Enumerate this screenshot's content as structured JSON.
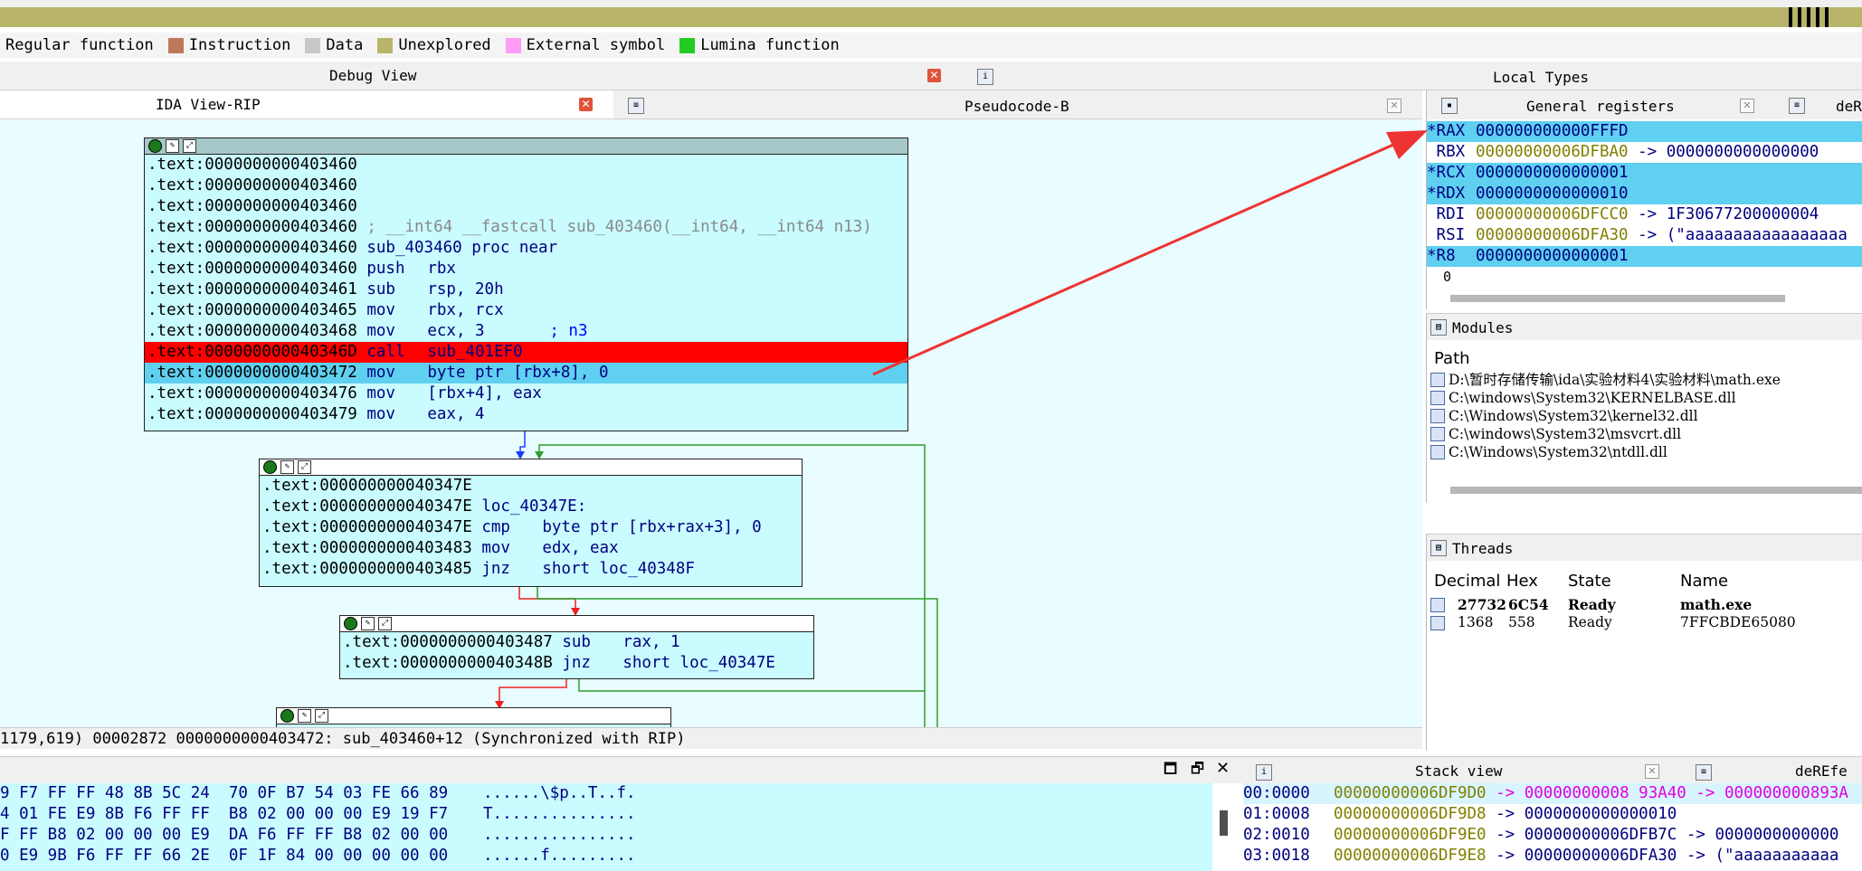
{
  "colors": {
    "nav_band": "#b8b46a",
    "graph_bg": "#e9fcff",
    "node_bg": "#c9fbff",
    "highlight_current": "#5fd0f0",
    "highlight_breakpoint": "#ff0000",
    "arrow": "#ee3333",
    "register_changed": "#5fd0f0"
  },
  "legend": [
    {
      "label": "Regular function",
      "color": "none"
    },
    {
      "label": "Instruction",
      "color": "#c0785a"
    },
    {
      "label": "Data",
      "color": "#c8c8c8"
    },
    {
      "label": "Unexplored",
      "color": "#b8b46a"
    },
    {
      "label": "External symbol",
      "color": "#ff9cf8"
    },
    {
      "label": "Lumina function",
      "color": "#22cc22"
    }
  ],
  "tabs": {
    "debug_view": "Debug View",
    "local_types": "Local Types",
    "ida_view": "IDA View-RIP",
    "pseudocode": "Pseudocode-B",
    "general_registers": "General registers",
    "dere_top": "deRe",
    "modules": "Modules",
    "threads": "Threads",
    "stack_view": "Stack view",
    "dere_bottom": "deREfe"
  },
  "node1": [
    {
      "addr": ".text:0000000000403460",
      "mnem": "",
      "ops": "",
      "style": ""
    },
    {
      "addr": ".text:0000000000403460",
      "mnem": "",
      "ops": "",
      "style": ""
    },
    {
      "addr": ".text:0000000000403460",
      "mnem": "",
      "ops": "",
      "style": ""
    },
    {
      "addr": ".text:0000000000403460",
      "mnem": "; __int64 __fastcall sub_403460(__int64, __int64 n13)",
      "ops": "",
      "style": "comment"
    },
    {
      "addr": ".text:0000000000403460",
      "mnem": "sub_403460 proc near",
      "ops": "",
      "style": ""
    },
    {
      "addr": ".text:0000000000403460",
      "mnem": "push",
      "ops": "rbx",
      "style": ""
    },
    {
      "addr": ".text:0000000000403461",
      "mnem": "sub",
      "ops": "rsp, 20h",
      "style": ""
    },
    {
      "addr": ".text:0000000000403465",
      "mnem": "mov",
      "ops": "rbx, rcx",
      "style": ""
    },
    {
      "addr": ".text:0000000000403468",
      "mnem": "mov",
      "ops": "ecx, 3",
      "comment": "; n3",
      "style": ""
    },
    {
      "addr": ".text:000000000040346D",
      "mnem": "call",
      "ops": "sub_401EF0",
      "style": "breakpoint"
    },
    {
      "addr": ".text:0000000000403472",
      "mnem": "mov",
      "ops": "byte ptr [rbx+8], 0",
      "style": "current"
    },
    {
      "addr": ".text:0000000000403476",
      "mnem": "mov",
      "ops": "[rbx+4], eax",
      "style": ""
    },
    {
      "addr": ".text:0000000000403479",
      "mnem": "mov",
      "ops": "eax, 4",
      "style": ""
    }
  ],
  "node2": [
    {
      "addr": ".text:000000000040347E",
      "mnem": "",
      "ops": ""
    },
    {
      "addr": ".text:000000000040347E",
      "mnem": "loc_40347E:",
      "ops": ""
    },
    {
      "addr": ".text:000000000040347E",
      "mnem": "cmp",
      "ops": "byte ptr [rbx+rax+3], 0"
    },
    {
      "addr": ".text:0000000000403483",
      "mnem": "mov",
      "ops": "edx, eax"
    },
    {
      "addr": ".text:0000000000403485",
      "mnem": "jnz",
      "ops": "short loc_40348F"
    }
  ],
  "node3": [
    {
      "addr": ".text:0000000000403487",
      "mnem": "sub",
      "ops": "rax, 1"
    },
    {
      "addr": ".text:000000000040348B",
      "mnem": "jnz",
      "ops": "short loc_40347E"
    }
  ],
  "status": {
    "coords": "1179,619)",
    "offset": "00002872",
    "location": "0000000000403472: sub_403460+12",
    "sync": "(Synchronized with RIP)"
  },
  "registers": [
    {
      "name": "*RAX",
      "value": "000000000000FFFD",
      "deref": "",
      "changed": true
    },
    {
      "name": " RBX",
      "value": "00000000006DFBA0",
      "deref": "-> 0000000000000000",
      "changed": false
    },
    {
      "name": "*RCX",
      "value": "0000000000000001",
      "deref": "",
      "changed": true
    },
    {
      "name": "*RDX",
      "value": "0000000000000010",
      "deref": "",
      "changed": true
    },
    {
      "name": " RDI",
      "value": "00000000006DFCC0",
      "deref": "-> 1F30677200000004",
      "changed": false
    },
    {
      "name": " RSI",
      "value": "00000000006DFA30",
      "deref": "-> (\"aaaaaaaaaaaaaaaaa",
      "changed": false
    },
    {
      "name": "*R8",
      "value": "0000000000000001",
      "deref": "",
      "changed": true
    }
  ],
  "registers_footer": "0",
  "modules": {
    "header": "Path",
    "items": [
      "D:\\暂时存储传输\\ida\\实验材料4\\实验材料\\math.exe",
      "C:\\windows\\System32\\KERNELBASE.dll",
      "C:\\Windows\\System32\\kernel32.dll",
      "C:\\windows\\System32\\msvcrt.dll",
      "C:\\Windows\\System32\\ntdll.dll"
    ]
  },
  "threads": {
    "columns": [
      "Decimal",
      "Hex",
      "State",
      "Name"
    ],
    "rows": [
      {
        "decimal": "27732",
        "hex": "6C54",
        "state": "Ready",
        "name": "math.exe",
        "bold": true
      },
      {
        "decimal": "1368",
        "hex": "558",
        "state": "Ready",
        "name": "7FFCBDE65080",
        "bold": false
      }
    ]
  },
  "hexdump": [
    {
      "bytes": "9 F7 FF FF 48 8B 5C 24  70 0F B7 54 03 FE 66 89",
      "ascii": "......\\$p..T..f."
    },
    {
      "bytes": "4 01 FE E9 8B F6 FF FF  B8 02 00 00 00 E9 19 F7",
      "ascii": "T..............."
    },
    {
      "bytes": "F FF B8 02 00 00 00 E9  DA F6 FF FF B8 02 00 00",
      "ascii": "................"
    },
    {
      "bytes": "0 E9 9B F6 FF FF 66 2E  0F 1F 84 00 00 00 00 00",
      "ascii": "......f........."
    }
  ],
  "stack": [
    {
      "idx": "00:0000",
      "addr": "00000000006DF9D0",
      "v1": "-> 00000000008 93A40",
      "v2": "-> 000000000893A"
    },
    {
      "idx": "01:0008",
      "addr": "00000000006DF9D8",
      "v1": "-> 0000000000000010",
      "v2": ""
    },
    {
      "idx": "02:0010",
      "addr": "00000000006DF9E0",
      "v1": "-> 00000000006DFB7C",
      "v2": "-> 0000000000000"
    },
    {
      "idx": "03:0018",
      "addr": "00000000006DF9E8",
      "v1": "-> 00000000006DFA30",
      "v2": "-> (\"aaaaaaaaaaa"
    }
  ]
}
